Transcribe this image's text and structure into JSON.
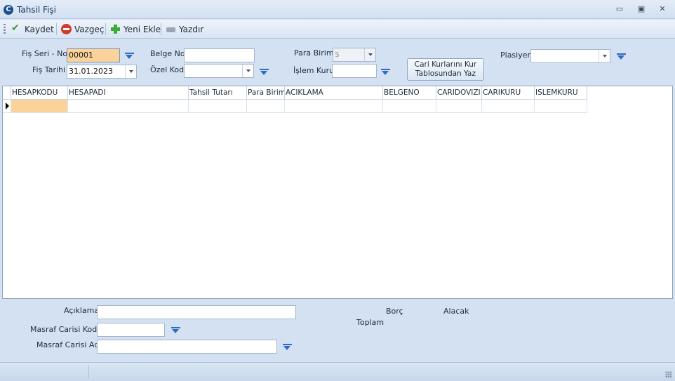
{
  "window": {
    "title": "Tahsil Fişi",
    "app_icon_letter": "C",
    "controls": {
      "minimize": "▭",
      "maximize": "▣",
      "close": "✕"
    }
  },
  "toolbar": {
    "save_label": "Kaydet",
    "cancel_label": "Vazgeç",
    "new_label": "Yeni Ekle",
    "print_label": "Yazdır"
  },
  "header": {
    "fis_seri_no_label": "Fiş Seri - No",
    "fis_seri_no_value": "00001",
    "fis_tarihi_label": "Fiş Tarihi",
    "fis_tarihi_value": "31.01.2023",
    "belge_no_label": "Belge No",
    "belge_no_value": "",
    "ozel_kod_label": "Özel Kod",
    "ozel_kod_value": "",
    "para_birimi_label": "Para Birimi",
    "para_birimi_value": "$",
    "islem_kuru_label": "İşlem Kuru",
    "islem_kuru_value": "",
    "kur_button_label": "Cari Kurlarını Kur Tablosundan Yaz",
    "plasiyer_label": "Plasiyer",
    "plasiyer_value": ""
  },
  "grid": {
    "columns": [
      "HESAPKODU",
      "HESAPADI",
      "Tahsil Tutarı",
      "Para Birimi",
      "ACIKLAMA",
      "BELGENO",
      "CARIDOVIZI",
      "CARIKURU",
      "ISLEMKURU"
    ],
    "rows": [
      [
        "",
        "",
        "",
        "",
        "",
        "",
        "",
        "",
        ""
      ]
    ]
  },
  "footer": {
    "aciklama_label": "Açıklama",
    "aciklama_value": "",
    "masraf_kodu_label": "Masraf Carisi Kodu",
    "masraf_kodu_value": "",
    "masraf_adi_label": "Masraf Carisi Adı",
    "masraf_adi_value": "",
    "borc_label": "Borç",
    "alacak_label": "Alacak",
    "toplam_label": "Toplam"
  },
  "colors": {
    "background": "#d4e1f2",
    "highlight": "#fbd39a",
    "accent_blue": "#2e6bc4"
  }
}
